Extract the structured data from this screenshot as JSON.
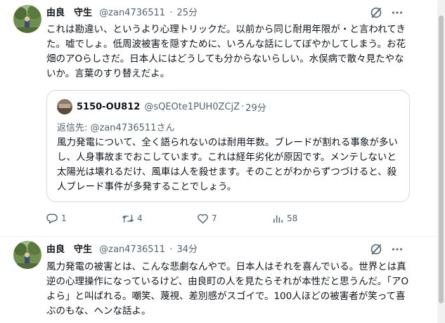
{
  "colors": {
    "text": "#0f1419",
    "muted": "#536471",
    "border": "#cfd9de"
  },
  "post1": {
    "author_name": "由良　守生",
    "author_handle": "@zan4736511",
    "separator": "·",
    "time": "25分",
    "text": "これは勘違い、というより心理トリックだ。以前から同じ耐用年限が・と言われてきた。嘘でしょ。低周波被害を隠すために、いろんな話にしてぼやかしてしまう。お花畑のアOらしさだ。日本人にはどうしても分からないらしい。水俣病で散々見たやないか。言葉のすり替えだよ。",
    "icons": {
      "grok": "grok-icon",
      "more": "more-icon"
    },
    "quote": {
      "author_name": "5150-OU812",
      "author_handle": "@sQEOte1PUH0ZCjZ",
      "separator": "·",
      "time": "29分",
      "reply_prefix": "返信先: ",
      "reply_to": "@zan4736511さん",
      "text": "風力発電について、全く語られないのは耐用年数。ブレードが割れる事象が多いし、人身事故までおこしています。これは経年劣化が原因です。メンテしないと太陽光は壊れるだけ、風車は人を殺せます。そのことがわからずつづけると、殺人ブレード事件が多発することでしょう。"
    },
    "actions": {
      "reply_count": "1",
      "repost_count": "4",
      "like_count": "7",
      "views_count": "58"
    }
  },
  "post2": {
    "author_name": "由良　守生",
    "author_handle": "@zan4736511",
    "separator": "·",
    "time": "34分",
    "text": "風力発電の被害とは、こんな悲劇なんやで。日本人はそれを喜んでいる。世界とは真逆の心理操作になっているけど、由良町の人を見たらそれが本性だと思うんだ。「アOよら」と叫ばれる。嘲笑、蔑視、差別感がスゴイで。100人ほどの被害者が笑って喜ぶのもな、ヘンな話よ。"
  }
}
